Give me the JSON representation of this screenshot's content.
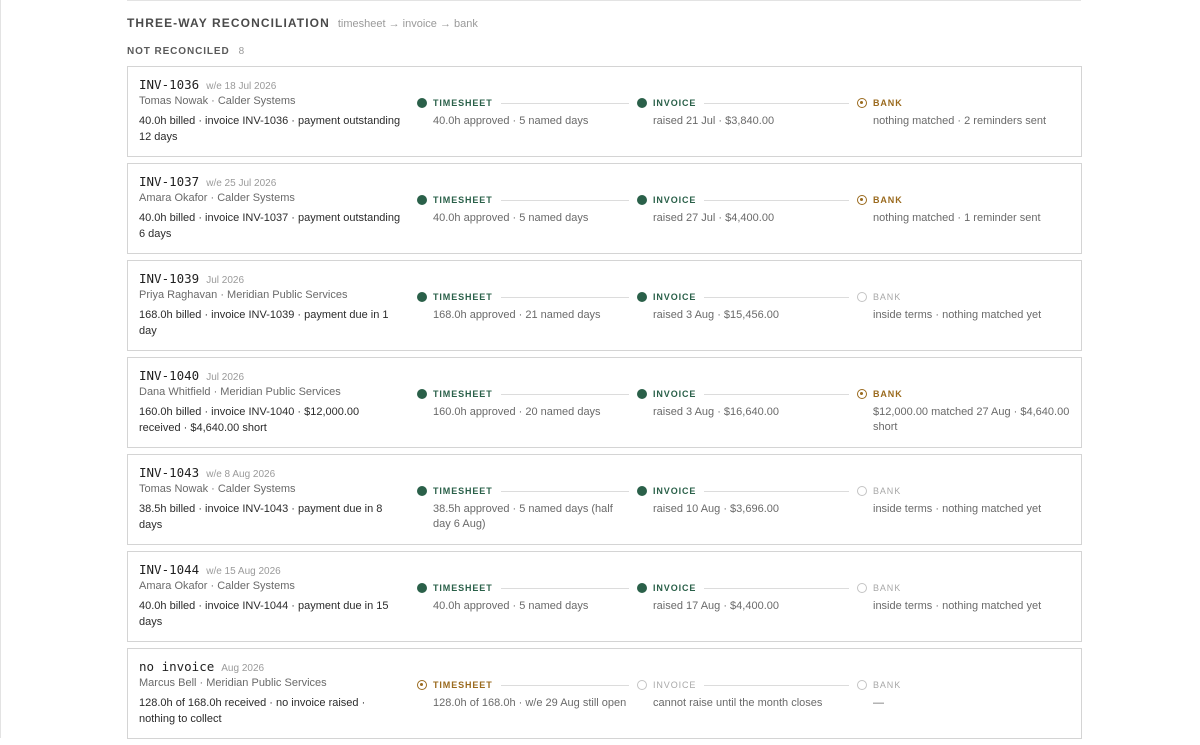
{
  "header": {
    "title": "THREE-WAY RECONCILIATION",
    "subtitle": "timesheet → invoice → bank"
  },
  "section": {
    "label": "NOT RECONCILED",
    "count": "8"
  },
  "colors": {
    "ok": "#2a6049",
    "warn": "#9a6a1e",
    "empty": "#c4c4c4",
    "border": "#d4d4d4"
  },
  "cards": [
    {
      "id": "INV-1036",
      "period": "w/e 18 Jul 2026",
      "who": "Tomas Nowak · Calder Systems",
      "summary": "40.0h billed · invoice INV-1036 · payment outstanding 12 days",
      "stages": [
        {
          "label": "TIMESHEET",
          "status": "ok",
          "detail": "40.0h approved · 5 named days"
        },
        {
          "label": "INVOICE",
          "status": "ok",
          "detail": "raised 21 Jul · $3,840.00"
        },
        {
          "label": "BANK",
          "status": "warn",
          "detail": "nothing matched · 2 reminders sent"
        }
      ]
    },
    {
      "id": "INV-1037",
      "period": "w/e 25 Jul 2026",
      "who": "Amara Okafor · Calder Systems",
      "summary": "40.0h billed · invoice INV-1037 · payment outstanding 6 days",
      "stages": [
        {
          "label": "TIMESHEET",
          "status": "ok",
          "detail": "40.0h approved · 5 named days"
        },
        {
          "label": "INVOICE",
          "status": "ok",
          "detail": "raised 27 Jul · $4,400.00"
        },
        {
          "label": "BANK",
          "status": "warn",
          "detail": "nothing matched · 1 reminder sent"
        }
      ]
    },
    {
      "id": "INV-1039",
      "period": "Jul 2026",
      "who": "Priya Raghavan · Meridian Public Services",
      "summary": "168.0h billed · invoice INV-1039 · payment due in 1 day",
      "stages": [
        {
          "label": "TIMESHEET",
          "status": "ok",
          "detail": "168.0h approved · 21 named days"
        },
        {
          "label": "INVOICE",
          "status": "ok",
          "detail": "raised 3 Aug · $15,456.00"
        },
        {
          "label": "BANK",
          "status": "empty",
          "detail": "inside terms · nothing matched yet"
        }
      ]
    },
    {
      "id": "INV-1040",
      "period": "Jul 2026",
      "who": "Dana Whitfield · Meridian Public Services",
      "summary": "160.0h billed · invoice INV-1040 · $12,000.00 received · $4,640.00 short",
      "stages": [
        {
          "label": "TIMESHEET",
          "status": "ok",
          "detail": "160.0h approved · 20 named days"
        },
        {
          "label": "INVOICE",
          "status": "ok",
          "detail": "raised 3 Aug · $16,640.00"
        },
        {
          "label": "BANK",
          "status": "warn",
          "detail": "$12,000.00 matched 27 Aug · $4,640.00 short"
        }
      ]
    },
    {
      "id": "INV-1043",
      "period": "w/e 8 Aug 2026",
      "who": "Tomas Nowak · Calder Systems",
      "summary": "38.5h billed · invoice INV-1043 · payment due in 8 days",
      "stages": [
        {
          "label": "TIMESHEET",
          "status": "ok",
          "detail": "38.5h approved · 5 named days (half day 6 Aug)"
        },
        {
          "label": "INVOICE",
          "status": "ok",
          "detail": "raised 10 Aug · $3,696.00"
        },
        {
          "label": "BANK",
          "status": "empty",
          "detail": "inside terms · nothing matched yet"
        }
      ]
    },
    {
      "id": "INV-1044",
      "period": "w/e 15 Aug 2026",
      "who": "Amara Okafor · Calder Systems",
      "summary": "40.0h billed · invoice INV-1044 · payment due in 15 days",
      "stages": [
        {
          "label": "TIMESHEET",
          "status": "ok",
          "detail": "40.0h approved · 5 named days"
        },
        {
          "label": "INVOICE",
          "status": "ok",
          "detail": "raised 17 Aug · $4,400.00"
        },
        {
          "label": "BANK",
          "status": "empty",
          "detail": "inside terms · nothing matched yet"
        }
      ]
    },
    {
      "id": "no invoice",
      "period": "Aug 2026",
      "who": "Marcus Bell · Meridian Public Services",
      "summary": "128.0h of 168.0h received · no invoice raised · nothing to collect",
      "stages": [
        {
          "label": "TIMESHEET",
          "status": "warn",
          "detail": "128.0h of 168.0h · w/e 29 Aug still open"
        },
        {
          "label": "INVOICE",
          "status": "empty",
          "detail": "cannot raise until the month closes"
        },
        {
          "label": "BANK",
          "status": "empty",
          "detail": "—"
        }
      ]
    }
  ]
}
